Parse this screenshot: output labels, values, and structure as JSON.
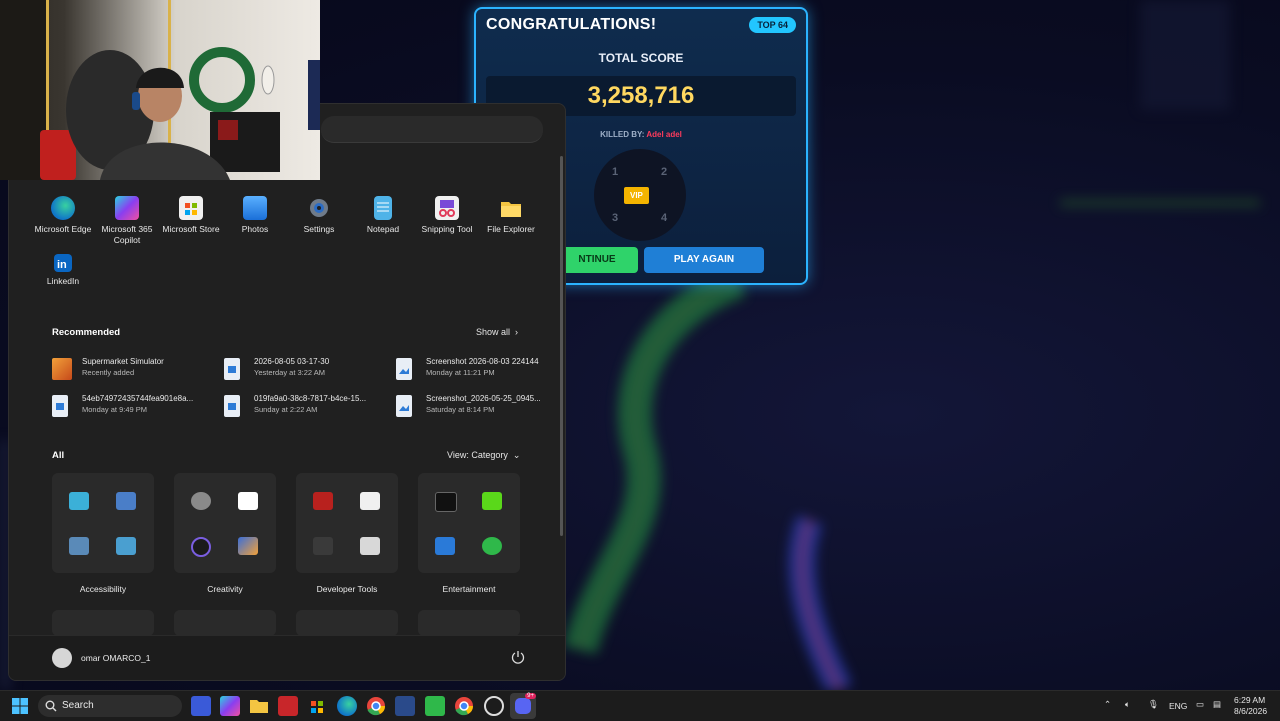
{
  "game": {
    "panel_title": "CONGRATULATIONS!",
    "rank_badge": "TOP 64",
    "total_label": "TOTAL SCORE",
    "total_score": "3,258,716",
    "killed_by_label": "KILLED BY:",
    "killer_name": "Adel adel",
    "wheel_numbers": [
      "1",
      "2",
      "3",
      "4"
    ],
    "vip_label": "VIP",
    "continue_label": "CONTINUE",
    "continue_visible_text": "NTINUE",
    "play_again_label": "PLAY AGAIN"
  },
  "start_menu": {
    "pinned": [
      {
        "label": "Microsoft Edge",
        "icon": "edge-icon"
      },
      {
        "label": "Microsoft 365 Copilot",
        "icon": "m365-copilot-icon"
      },
      {
        "label": "Microsoft Store",
        "icon": "store-icon"
      },
      {
        "label": "Photos",
        "icon": "photos-icon"
      },
      {
        "label": "Settings",
        "icon": "gear-icon"
      },
      {
        "label": "Notepad",
        "icon": "notepad-icon"
      },
      {
        "label": "Snipping Tool",
        "icon": "snipping-tool-icon"
      },
      {
        "label": "File Explorer",
        "icon": "folder-icon"
      },
      {
        "label": "LinkedIn",
        "icon": "linkedin-icon"
      }
    ],
    "recommended_title": "Recommended",
    "show_all_label": "Show all",
    "recommended": [
      {
        "name": "Supermarket Simulator",
        "sub": "Recently added"
      },
      {
        "name": "2026-08-05 03-17-30",
        "sub": "Yesterday at 3:22 AM"
      },
      {
        "name": "Screenshot 2026-08-03 224144",
        "sub": "Monday at 11:21 PM"
      },
      {
        "name": "54eb74972435744fea901e8a...",
        "sub": "Monday at 9:49 PM"
      },
      {
        "name": "019fa9a0-38c8-7817-b4ce-15...",
        "sub": "Sunday at 2:22 AM"
      },
      {
        "name": "Screenshot_2026-05-25_0945...",
        "sub": "Saturday at 8:14 PM"
      }
    ],
    "all_title": "All",
    "view_label": "View: Category",
    "categories": [
      "Accessibility",
      "Creativity",
      "Developer Tools",
      "Entertainment"
    ],
    "user_name": "omar OMARCO_1"
  },
  "taskbar": {
    "search_label": "Search",
    "language": "ENG",
    "time": "6:29 AM",
    "date": "8/6/2026",
    "discord_badge": "9+"
  }
}
